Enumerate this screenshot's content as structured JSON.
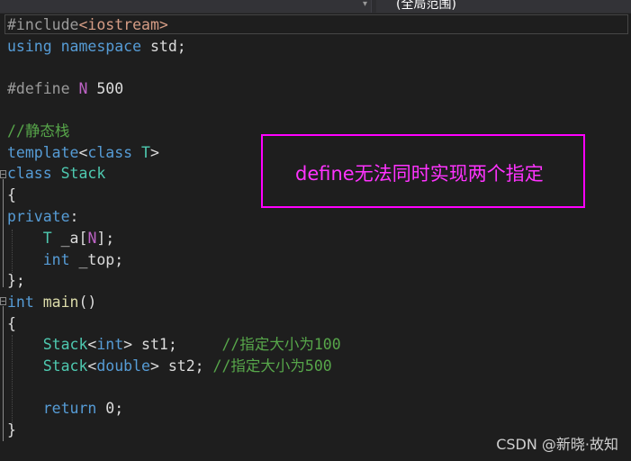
{
  "toolbar": {
    "scope_dropdown_label": "(全局范围)"
  },
  "code": {
    "l1_pp": "#include",
    "l1_inc": "<iostream>",
    "l2_kw1": "using",
    "l2_kw2": "namespace",
    "l2_rest": " std;",
    "l4_pp": "#define ",
    "l4_macro": "N",
    "l4_num": " 500",
    "l6_comment": "//静态栈",
    "l7_kw1": "template",
    "l7_op1": "<",
    "l7_kw2": "class",
    "l7_ty": " T",
    "l7_op2": ">",
    "l8_kw": "class",
    "l8_ty": " Stack",
    "l9": "{",
    "l10_kw": "private",
    "l10_colon": ":",
    "l11_ty": "T",
    "l11_rest": " _a[",
    "l11_macro": "N",
    "l11_end": "];",
    "l12_kw": "int",
    "l12_rest": " _top;",
    "l13": "};",
    "l14_kw": "int",
    "l14_fn": " main",
    "l14_rest": "()",
    "l15": "{",
    "l16_ty": "Stack",
    "l16_lt": "<",
    "l16_kw": "int",
    "l16_gt": ">",
    "l16_var": " st1;     ",
    "l16_cm": "//指定大小为100",
    "l17_ty": "Stack",
    "l17_lt": "<",
    "l17_kw": "double",
    "l17_gt": ">",
    "l17_var": " st2; ",
    "l17_cm": "//指定大小为500",
    "l19_kw": "return",
    "l19_num": " 0",
    "l19_end": ";",
    "l20": "}"
  },
  "annotation": {
    "text": "define无法同时实现两个指定"
  },
  "watermark": {
    "text": "CSDN @新晓·故知"
  },
  "colors": {
    "background": "#1e1e1e",
    "keyword": "#569cd6",
    "type": "#4ec9b0",
    "function": "#dcdcaa",
    "include_string": "#d69d85",
    "comment": "#57a64a",
    "number": "#b5cea8",
    "macro": "#bd63c5",
    "annotation": "#ff00ff"
  }
}
